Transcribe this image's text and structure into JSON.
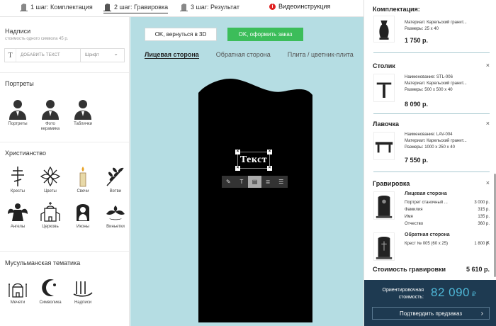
{
  "steps": [
    {
      "label": "1 шаг: Комплектация"
    },
    {
      "label": "2 шаг: Гравировка"
    },
    {
      "label": "3 шаг: Результат"
    },
    {
      "label": "Видеоинструкция"
    }
  ],
  "left": {
    "inscriptions_title": "Надписи",
    "inscriptions_hint": "стоимость одного символа 45 р.",
    "add_text": "ДОБАВИТЬ ТЕКСТ",
    "font_placeholder": "Шрифт",
    "portraits_title": "Портреты",
    "portraits": [
      "Портреты",
      "Фото керамика",
      "Таблички"
    ],
    "christianity_title": "Христианство",
    "christianity": [
      "Кресты",
      "Цветы",
      "Свечи",
      "Ветви",
      "Ангелы",
      "Церковь",
      "Иконы",
      "Виньетки"
    ],
    "muslim_title": "Мусульманская тематика",
    "muslim": [
      "Мечети",
      "Символика",
      "Надписи"
    ]
  },
  "canvas": {
    "back_button": "OK, вернуться в 3D",
    "order_button": "OK, оформить заказ",
    "tabs": [
      "Лицевая сторона",
      "Обратная сторона",
      "Плита / цветник-плита"
    ],
    "text_label": "Текст"
  },
  "right": {
    "kit_title": "Комплектация:",
    "kit_material": "Материал: Карельский гранит...",
    "kit_size": "Размеры: 25 x 40",
    "kit_price": "1 750 р.",
    "table_title": "Столик",
    "table_name": "Наименование: STL-006",
    "table_material": "Материал: Карельский гранит...",
    "table_size": "Размеры: 500 x 500 x 40",
    "table_price": "8 090 р.",
    "bench_title": "Лавочка",
    "bench_name": "Наименование: LAV-004",
    "bench_material": "Материал: Карельский гранит...",
    "bench_size": "Размеры: 1000 x 250 x 40",
    "bench_price": "7 550 р.",
    "engraving_title": "Гравировка",
    "front_title": "Лицевая сторона",
    "front_rows": [
      {
        "name": "Портрет станочный ...",
        "price": "3 000 р."
      },
      {
        "name": "Фамилия",
        "price": "315 р."
      },
      {
        "name": "Имя",
        "price": "135 р."
      },
      {
        "name": "Отчество",
        "price": "360 р."
      }
    ],
    "back_title": "Обратная сторона",
    "back_rows": [
      {
        "name": "Крест № 005 (60 x 25)",
        "price": "1 800 р."
      }
    ],
    "engraving_cost_label": "Стоимость гравировки",
    "engraving_cost_value": "5 610 р.",
    "estimate_label": "Ориентировочная стоимость:",
    "estimate_value": "82 090",
    "estimate_currency": "₽",
    "confirm_button": "Подтвердить предзаказ",
    "close_symbol": "×"
  }
}
